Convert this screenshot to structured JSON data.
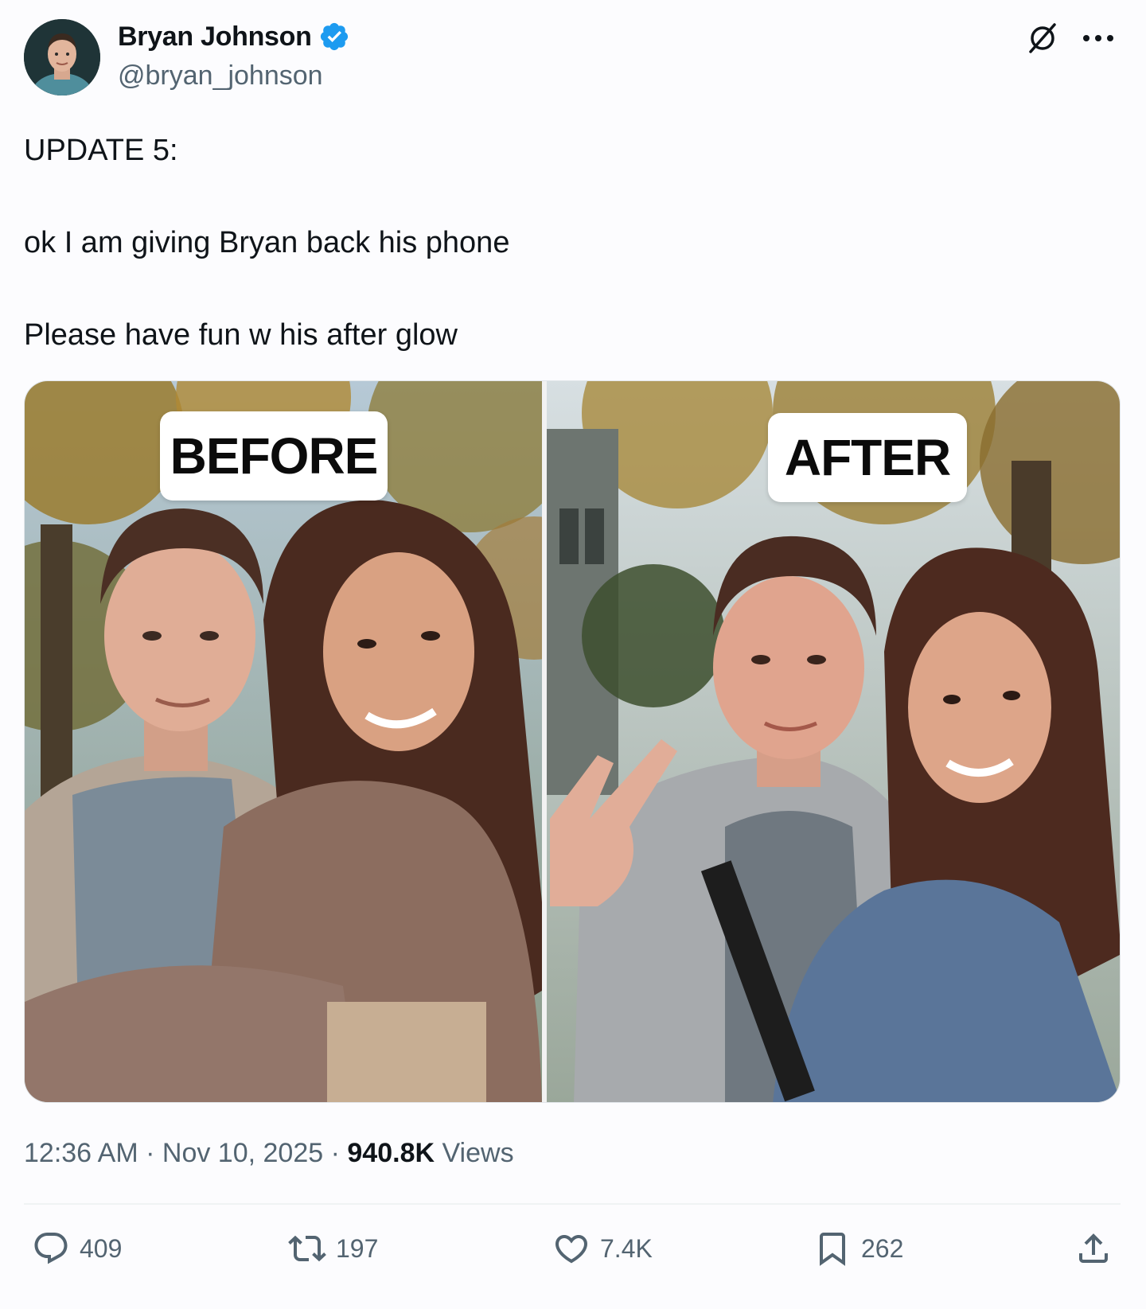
{
  "author": {
    "name": "Bryan Johnson",
    "handle": "@bryan_johnson",
    "verified": true,
    "verified_color": "#1d9bf0"
  },
  "header_icons": [
    "grok-icon",
    "more-options-icon"
  ],
  "tweet": {
    "lines": [
      "UPDATE 5:",
      "ok I am giving Bryan back his phone",
      "Please have fun w his after glow"
    ]
  },
  "media": {
    "left_label": "BEFORE",
    "right_label": "AFTER"
  },
  "meta": {
    "time": "12:36 AM",
    "separator": "·",
    "date": "Nov 10, 2025",
    "views_count": "940.8K",
    "views_label": "Views"
  },
  "actions": {
    "replies": "409",
    "reposts": "197",
    "likes": "7.4K",
    "bookmarks": "262"
  },
  "colors": {
    "text": "#0f1419",
    "secondary": "#536471",
    "accent": "#1d9bf0"
  }
}
